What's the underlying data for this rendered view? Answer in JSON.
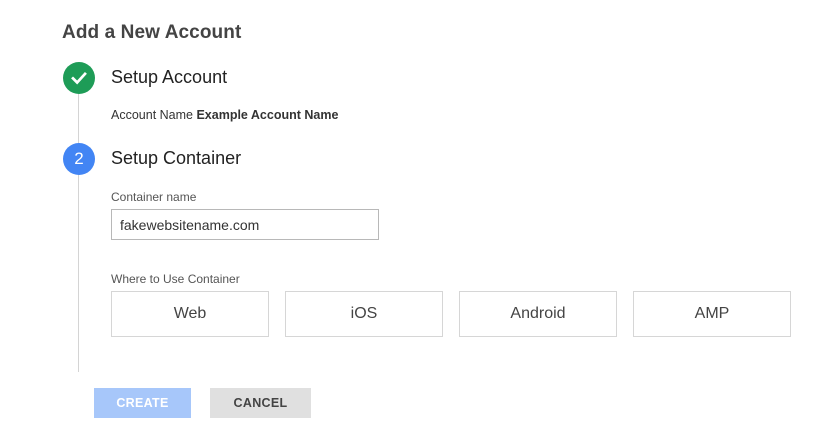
{
  "page": {
    "title": "Add a New Account"
  },
  "steps": {
    "step1": {
      "title": "Setup Account",
      "account_name_label": "Account Name",
      "account_name_value": "Example Account Name"
    },
    "step2": {
      "number": "2",
      "title": "Setup Container",
      "container_name_label": "Container name",
      "container_name_value": "fakewebsitename.com",
      "where_label": "Where to Use Container",
      "platforms": [
        "Web",
        "iOS",
        "Android",
        "AMP"
      ]
    }
  },
  "actions": {
    "create_label": "CREATE",
    "cancel_label": "CANCEL"
  },
  "colors": {
    "step_done": "#1e9c57",
    "step_current": "#4285f4",
    "create_disabled": "#a7c7fa",
    "cancel_bg": "#e0e0e0"
  },
  "icons": {
    "step1": "checkmark-icon"
  }
}
